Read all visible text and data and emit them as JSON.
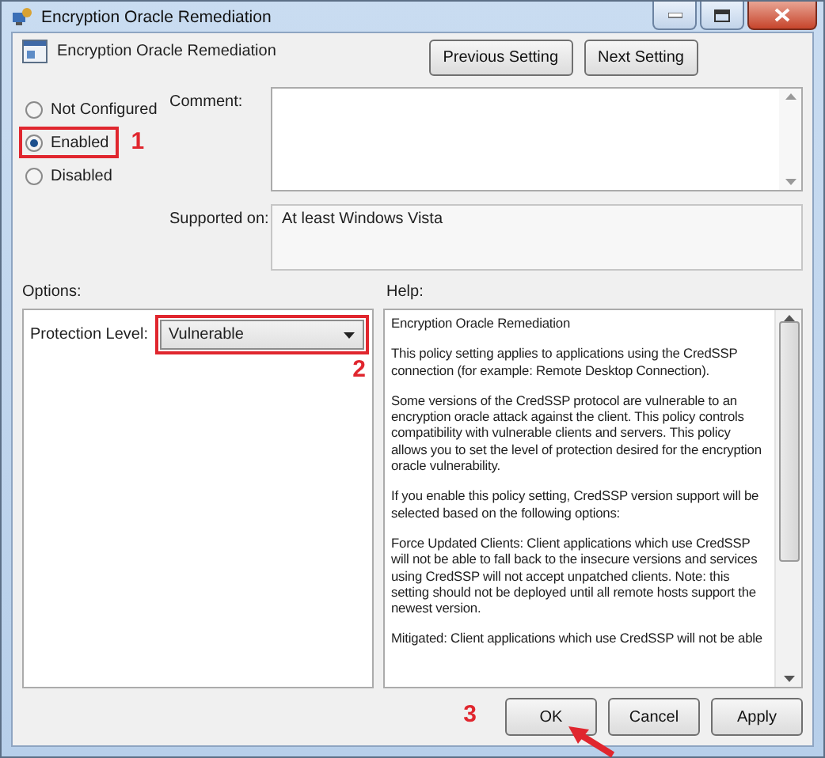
{
  "window": {
    "title": "Encryption Oracle Remediation"
  },
  "header": {
    "title": "Encryption Oracle Remediation",
    "buttons": [
      "Previous Setting",
      "Next Setting"
    ]
  },
  "state_options": [
    {
      "label": "Not Configured",
      "selected": false,
      "highlighted": false
    },
    {
      "label": "Enabled",
      "selected": true,
      "step": "1",
      "highlighted": true
    },
    {
      "label": "Disabled",
      "selected": false,
      "highlighted": false
    }
  ],
  "comment": {
    "label": "Comment:"
  },
  "supported_on": {
    "label": "Supported on:",
    "value": "At least Windows Vista"
  },
  "options": {
    "label": "Options:",
    "fields": [
      {
        "label": "Protection Level:",
        "value": "Vulnerable",
        "step": "2",
        "highlighted": true
      }
    ]
  },
  "help": {
    "label": "Help:",
    "paragraphs": [
      "Encryption Oracle Remediation",
      "This policy setting applies to applications using the CredSSP connection (for example: Remote Desktop Connection).",
      "Some versions of the CredSSP protocol are vulnerable to an encryption oracle attack against the client.  This policy controls compatibility with vulnerable clients and servers.  This policy allows you to set the level of protection desired for the encryption oracle vulnerability.",
      "If you enable this policy setting, CredSSP version support will be selected based on the following options:",
      "Force Updated Clients: Client applications which use CredSSP will not be able to fall back to the insecure versions and services using CredSSP will not accept unpatched clients. Note: this setting should not be deployed until all remote hosts support the newest version.",
      "Mitigated: Client applications which use CredSSP will not be able"
    ]
  },
  "buttons": [
    {
      "label": "OK",
      "step": "3",
      "pointed": true
    },
    {
      "label": "Cancel"
    },
    {
      "label": "Apply"
    }
  ]
}
